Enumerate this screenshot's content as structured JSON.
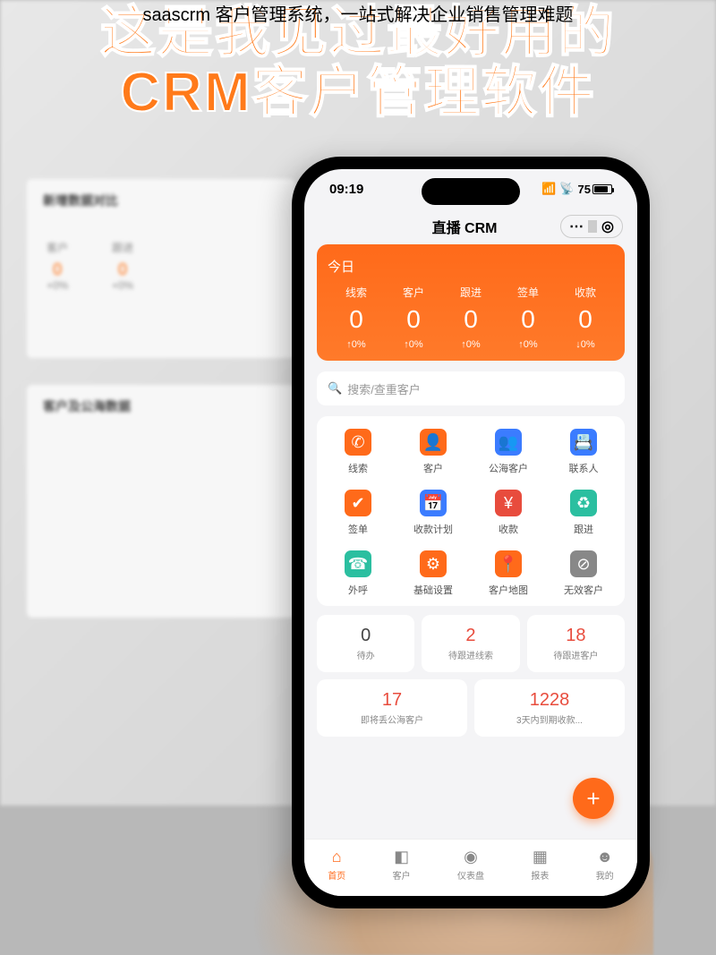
{
  "caption": "saascrm 客户管理系统，一站式解决企业销售管理难题",
  "headline_l1": "这是我见过最好用的",
  "headline_l2": "CRM客户管理软件",
  "bg": {
    "section1": "新增数据对比",
    "m1_label": "客户",
    "m1_delta": "+0%",
    "m2_label": "跟进",
    "m2_delta": "+0%",
    "section2": "客户及公海数据"
  },
  "statusbar": {
    "time": "09:19",
    "battery": "75"
  },
  "app_title": "直播 CRM",
  "today_label": "今日",
  "metrics": [
    {
      "label": "线索",
      "value": "0",
      "delta": "↑0%"
    },
    {
      "label": "客户",
      "value": "0",
      "delta": "↑0%"
    },
    {
      "label": "跟进",
      "value": "0",
      "delta": "↑0%"
    },
    {
      "label": "签单",
      "value": "0",
      "delta": "↑0%"
    },
    {
      "label": "收款",
      "value": "0",
      "delta": "↓0%"
    }
  ],
  "search_placeholder": "搜索/查重客户",
  "apps": [
    {
      "name": "线索",
      "color": "#ff6a1a",
      "glyph": "✆"
    },
    {
      "name": "客户",
      "color": "#ff6a1a",
      "glyph": "👤"
    },
    {
      "name": "公海客户",
      "color": "#3b7cff",
      "glyph": "👥"
    },
    {
      "name": "联系人",
      "color": "#3b7cff",
      "glyph": "📇"
    },
    {
      "name": "签单",
      "color": "#ff6a1a",
      "glyph": "✔"
    },
    {
      "name": "收款计划",
      "color": "#3b7cff",
      "glyph": "📅"
    },
    {
      "name": "收款",
      "color": "#e84c3d",
      "glyph": "¥"
    },
    {
      "name": "跟进",
      "color": "#2bbfa0",
      "glyph": "♻"
    },
    {
      "name": "外呼",
      "color": "#2bbfa0",
      "glyph": "☎"
    },
    {
      "name": "基础设置",
      "color": "#ff6a1a",
      "glyph": "⚙"
    },
    {
      "name": "客户地图",
      "color": "#ff6a1a",
      "glyph": "📍"
    },
    {
      "name": "无效客户",
      "color": "#888888",
      "glyph": "⊘"
    }
  ],
  "todos1": [
    {
      "num": "0",
      "label": "待办",
      "red": false
    },
    {
      "num": "2",
      "label": "待跟进线索",
      "red": true
    },
    {
      "num": "18",
      "label": "待跟进客户",
      "red": true
    }
  ],
  "todos2": [
    {
      "num": "17",
      "label": "即将丢公海客户",
      "red": true
    },
    {
      "num": "1228",
      "label": "3天内到期收款...",
      "red": true
    }
  ],
  "fab": "+",
  "tabs": [
    {
      "icon": "⌂",
      "label": "首页",
      "active": true
    },
    {
      "icon": "◧",
      "label": "客户",
      "active": false
    },
    {
      "icon": "◉",
      "label": "仪表盘",
      "active": false
    },
    {
      "icon": "▦",
      "label": "报表",
      "active": false
    },
    {
      "icon": "☻",
      "label": "我的",
      "active": false
    }
  ]
}
